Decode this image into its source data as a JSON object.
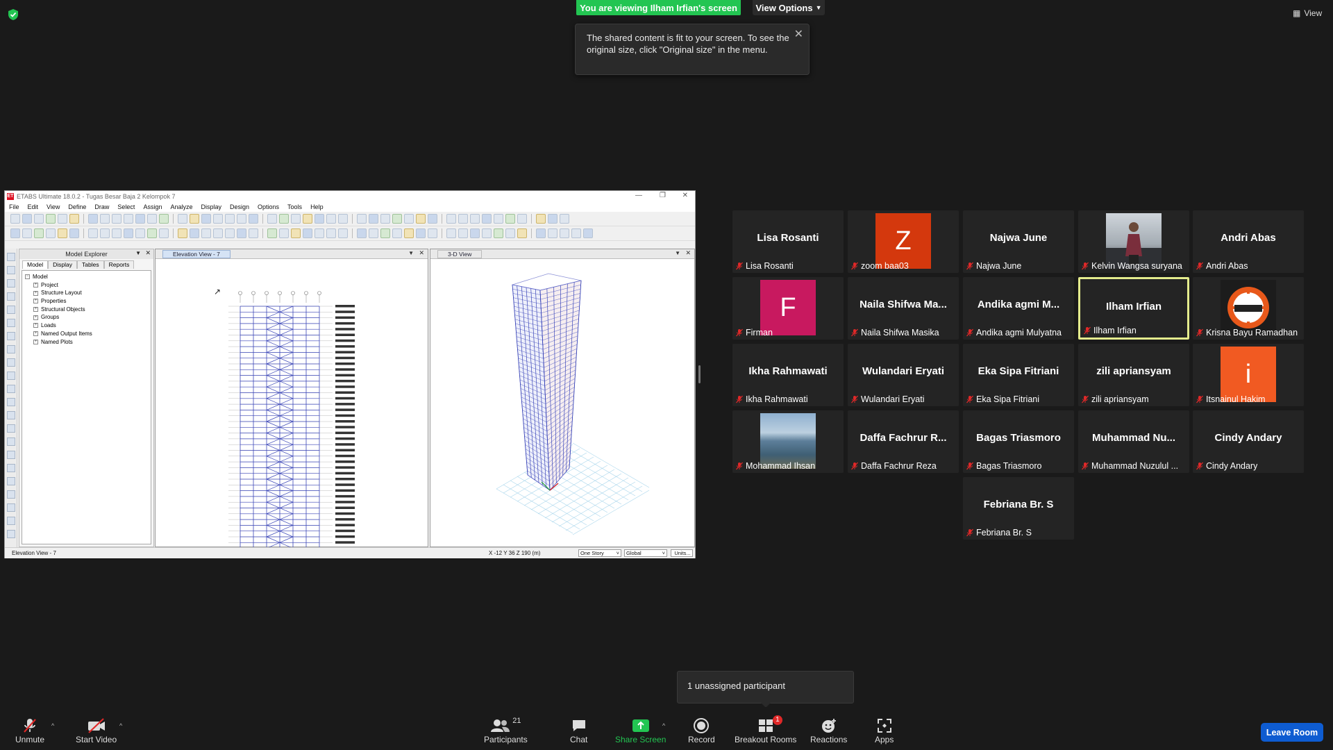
{
  "banner": {
    "viewing": "You are viewing Ilham Irfian's screen",
    "view_options": "View Options",
    "tooltip": "The shared content is fit to your screen. To see the original size, click \"Original size\" in the menu.",
    "view_label": "View"
  },
  "etabs": {
    "title": "ETABS Ultimate 18.0.2 - Tugas Besar Baja 2 Kelompok 7",
    "menu": [
      "File",
      "Edit",
      "View",
      "Define",
      "Draw",
      "Select",
      "Assign",
      "Analyze",
      "Display",
      "Design",
      "Options",
      "Tools",
      "Help"
    ],
    "explorer_title": "Model Explorer",
    "explorer_tabs": [
      "Model",
      "Display",
      "Tables",
      "Reports"
    ],
    "tree": [
      "Model",
      "Project",
      "Structure Layout",
      "Properties",
      "Structural Objects",
      "Groups",
      "Loads",
      "Named Output Items",
      "Named Plots"
    ],
    "elevation_tab": "Elevation View - 7",
    "view3d_tab": "3-D View",
    "status_left": "Elevation View - 7",
    "coords": "X -12  Y 36  Z 190 (m)",
    "story_select": "One Story",
    "coord_select": "Global",
    "units_button": "Units..."
  },
  "participants": [
    {
      "display": "Lisa Rosanti",
      "label": "Lisa Rosanti",
      "type": "name"
    },
    {
      "display": "Z",
      "label": "zoom baa03",
      "type": "letter",
      "color": "#d4380d"
    },
    {
      "display": "Najwa June",
      "label": "Najwa June",
      "type": "name"
    },
    {
      "display": "",
      "label": "Kelvin Wangsa suryana",
      "type": "photo"
    },
    {
      "display": "Andri Abas",
      "label": "Andri Abas",
      "type": "name"
    },
    {
      "display": "F",
      "label": "Firman",
      "type": "letter",
      "color": "#c8195f"
    },
    {
      "display": "Naila Shifwa Ma...",
      "label": "Naila Shifwa Masika",
      "type": "name"
    },
    {
      "display": "Andika agmi M...",
      "label": "Andika agmi Mulyatna",
      "type": "name"
    },
    {
      "display": "Ilham Irfian",
      "label": "Ilham Irfian",
      "type": "name",
      "active": true
    },
    {
      "display": "",
      "label": "Krisna Bayu Ramadhan",
      "type": "logo"
    },
    {
      "display": "Ikha Rahmawati",
      "label": "Ikha Rahmawati",
      "type": "name"
    },
    {
      "display": "Wulandari Eryati",
      "label": "Wulandari Eryati",
      "type": "name"
    },
    {
      "display": "Eka Sipa Fitriani",
      "label": "Eka Sipa Fitriani",
      "type": "name"
    },
    {
      "display": "zili apriansyam",
      "label": "zili apriansyam",
      "type": "name"
    },
    {
      "display": "i",
      "label": "Itsnainul Hakim",
      "type": "letter",
      "color": "#f15a22"
    },
    {
      "display": "",
      "label": "Mohammad Ihsan",
      "type": "landscape"
    },
    {
      "display": "Daffa Fachrur R...",
      "label": "Daffa Fachrur Reza",
      "type": "name"
    },
    {
      "display": "Bagas Triasmoro",
      "label": "Bagas Triasmoro",
      "type": "name"
    },
    {
      "display": "Muhammad  Nu...",
      "label": "Muhammad Nuzulul ...",
      "type": "name"
    },
    {
      "display": "Cindy Andary",
      "label": "Cindy Andary",
      "type": "name"
    },
    {
      "display": "Febriana Br. S",
      "label": "Febriana Br. S",
      "type": "name"
    }
  ],
  "unassigned": "1 unassigned participant",
  "bottombar": {
    "unmute": "Unmute",
    "start_video": "Start Video",
    "participants": "Participants",
    "participants_count": "21",
    "chat": "Chat",
    "share_screen": "Share Screen",
    "record": "Record",
    "breakout_rooms": "Breakout Rooms",
    "breakout_badge": "1",
    "reactions": "Reactions",
    "apps": "Apps",
    "leave_room": "Leave Room"
  },
  "colors": {
    "accent_green": "#23c552",
    "active_tile_border": "#e4ec8d",
    "leave_blue": "#0e5cd1",
    "mic_muted_red": "#e02828"
  }
}
